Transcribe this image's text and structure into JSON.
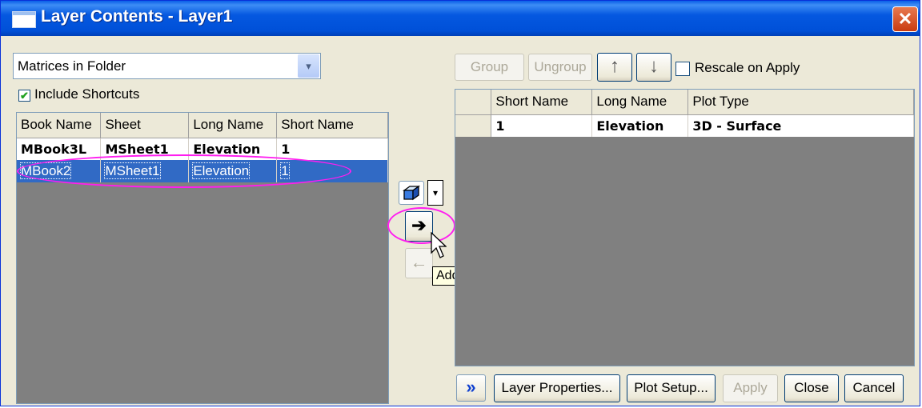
{
  "window": {
    "title": "Layer Contents - Layer1",
    "close_glyph": "✕"
  },
  "left": {
    "source_combo": {
      "value": "Matrices in Folder",
      "arrow_glyph": "▾"
    },
    "include_shortcuts": {
      "label": "Include Shortcuts",
      "checked": true,
      "check_glyph": "✔"
    },
    "grid": {
      "columns": [
        "Book Name",
        "Sheet",
        "Long Name",
        "Short Name"
      ],
      "rows": [
        {
          "cells": [
            "MBook3L",
            "MSheet1",
            "Elevation",
            "1"
          ],
          "style": "bold"
        },
        {
          "cells": [
            "MBook2",
            "MSheet1",
            "Elevation",
            "1"
          ],
          "style": "selected"
        }
      ]
    }
  },
  "middle": {
    "plot_type_icon": "cube-icon",
    "dropdown_glyph": "▾",
    "add_glyph": "➔",
    "remove_glyph": "←",
    "tooltip": "Add plot"
  },
  "right": {
    "toolbar": {
      "group": "Group",
      "ungroup": "Ungroup",
      "up_glyph": "↑",
      "down_glyph": "↓",
      "rescale_label": "Rescale on Apply",
      "rescale_checked": false
    },
    "grid": {
      "columns": [
        "",
        "Short Name",
        "Long Name",
        "Plot Type"
      ],
      "rows": [
        {
          "cells": [
            "",
            "1",
            "Elevation",
            "3D - Surface"
          ]
        }
      ]
    }
  },
  "footer": {
    "expand_glyph": "»",
    "layer_properties": "Layer Properties...",
    "plot_setup": "Plot Setup...",
    "apply": "Apply",
    "close": "Close",
    "cancel": "Cancel"
  },
  "colors": {
    "title_bar": "#0058e0",
    "selection": "#316ac5",
    "highlight_ring": "#ff1df0",
    "grid_background": "#808080"
  }
}
